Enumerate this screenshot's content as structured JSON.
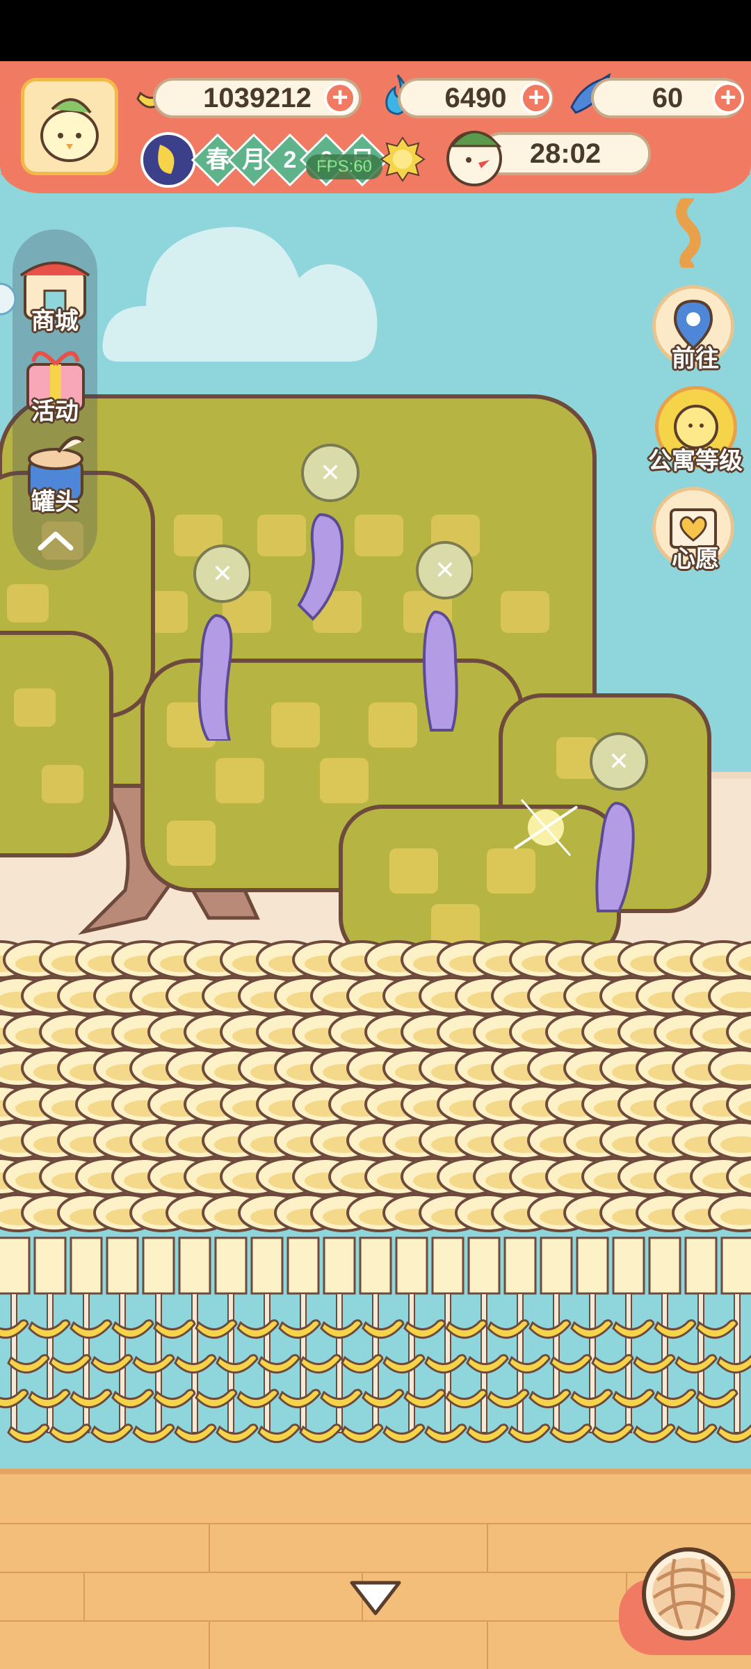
{
  "header": {
    "bananas": "1039212",
    "flames": "6490",
    "fish": "60",
    "timer": "28:02",
    "fps": "FPS:60"
  },
  "season": {
    "chars": [
      "春",
      "月",
      "2",
      "6",
      "日"
    ]
  },
  "side_menu": {
    "shop": "商城",
    "events": "活动",
    "cans": "罐头"
  },
  "right_menu": {
    "goto": "前往",
    "apartment_level": "公寓等级",
    "wish": "心愿"
  },
  "colors": {
    "header": "#f07a62",
    "sky": "#8fd6dc",
    "tree": "#b6b544",
    "flower": "#b49be6",
    "floor": "#f3bd7a"
  }
}
